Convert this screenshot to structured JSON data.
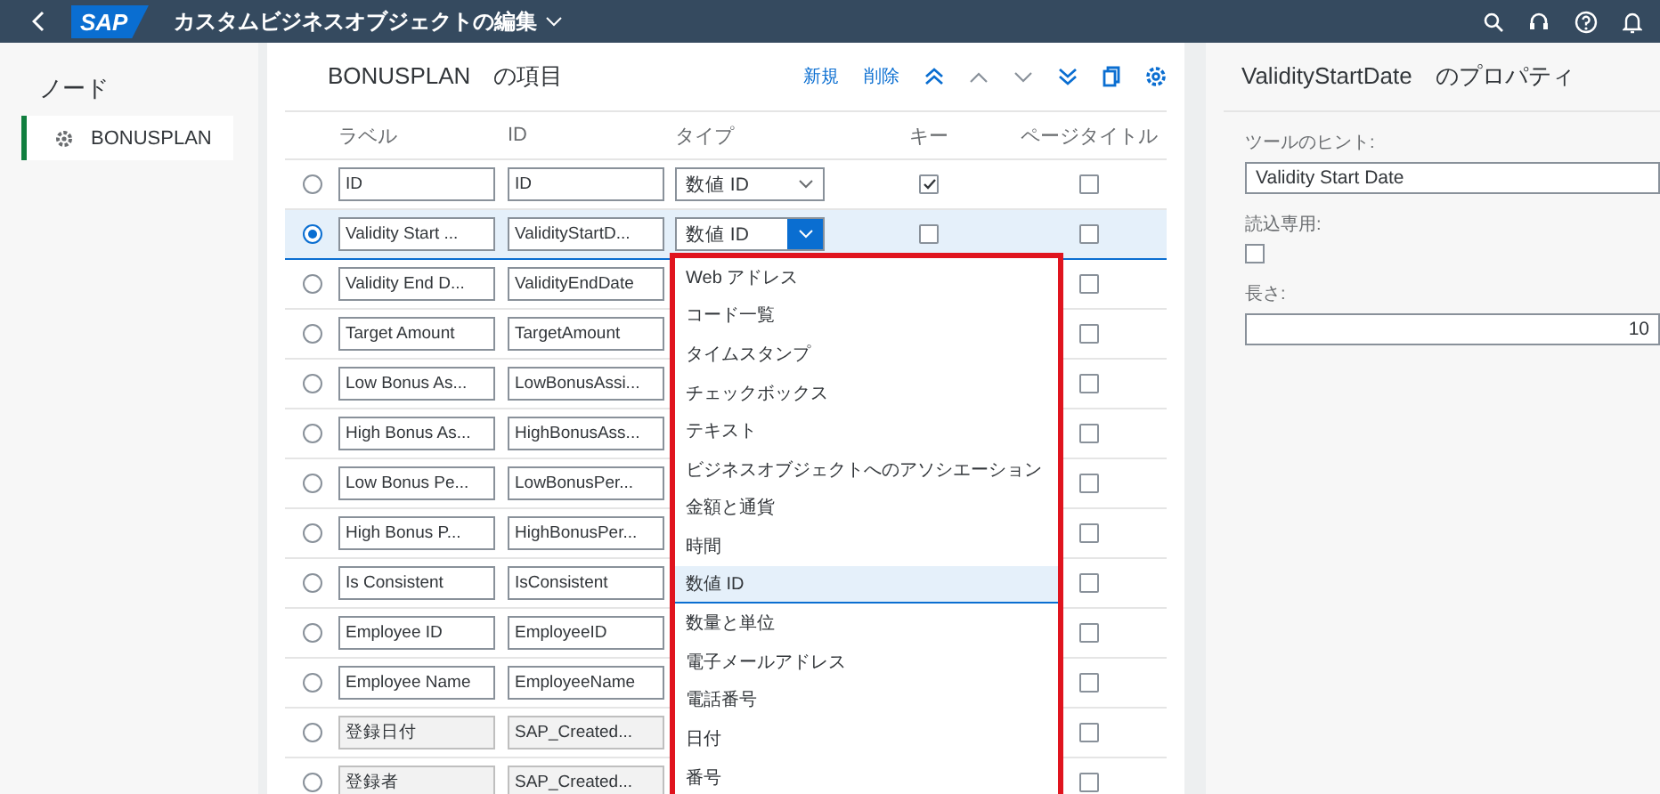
{
  "header": {
    "logo": "SAP",
    "title": "カスタムビジネスオブジェクトの編集"
  },
  "nodes": {
    "title": "ノード",
    "items": [
      {
        "label": "BONUSPLAN",
        "selected": true
      }
    ]
  },
  "fields": {
    "title": "BONUSPLAN　の項目",
    "actions": [
      "新規",
      "削除"
    ],
    "columns": [
      "ラベル",
      "ID",
      "タイプ",
      "キー",
      "ページタイトル"
    ],
    "rows": [
      {
        "selected": false,
        "label": "ID",
        "id": "ID",
        "readonly": false,
        "type": "数値 ID",
        "type_open": false,
        "key": true,
        "page_title": false
      },
      {
        "selected": true,
        "label": "Validity Start ...",
        "id": "ValidityStartD...",
        "readonly": false,
        "type": "数値 ID",
        "type_open": true,
        "key": false,
        "page_title": false
      },
      {
        "selected": false,
        "label": "Validity End D...",
        "id": "ValidityEndDate",
        "readonly": false,
        "page_title": false
      },
      {
        "selected": false,
        "label": "Target Amount",
        "id": "TargetAmount",
        "readonly": false,
        "page_title": false
      },
      {
        "selected": false,
        "label": "Low Bonus As...",
        "id": "LowBonusAssi...",
        "readonly": false,
        "page_title": false
      },
      {
        "selected": false,
        "label": "High Bonus As...",
        "id": "HighBonusAss...",
        "readonly": false,
        "page_title": false
      },
      {
        "selected": false,
        "label": "Low Bonus Pe...",
        "id": "LowBonusPer...",
        "readonly": false,
        "page_title": false
      },
      {
        "selected": false,
        "label": "High Bonus P...",
        "id": "HighBonusPer...",
        "readonly": false,
        "page_title": false
      },
      {
        "selected": false,
        "label": "Is Consistent",
        "id": "IsConsistent",
        "readonly": false,
        "page_title": false
      },
      {
        "selected": false,
        "label": "Employee ID",
        "id": "EmployeeID",
        "readonly": false,
        "page_title": false
      },
      {
        "selected": false,
        "label": "Employee Name",
        "id": "EmployeeName",
        "readonly": false,
        "page_title": false
      },
      {
        "selected": false,
        "label": "登録日付",
        "id": "SAP_Created...",
        "readonly": true,
        "page_title": false
      },
      {
        "selected": false,
        "label": "登録者",
        "id": "SAP_Created...",
        "readonly": true,
        "page_title": false
      }
    ]
  },
  "type_dropdown": {
    "options": [
      {
        "label": "Web アドレス",
        "selected": false
      },
      {
        "label": "コード一覧",
        "selected": false
      },
      {
        "label": "タイムスタンプ",
        "selected": false
      },
      {
        "label": "チェックボックス",
        "selected": false
      },
      {
        "label": "テキスト",
        "selected": false
      },
      {
        "label": "ビジネスオブジェクトへのアソシエーション",
        "selected": false
      },
      {
        "label": "金額と通貨",
        "selected": false
      },
      {
        "label": "時間",
        "selected": false
      },
      {
        "label": "数値 ID",
        "selected": true
      },
      {
        "label": "数量と単位",
        "selected": false
      },
      {
        "label": "電子メールアドレス",
        "selected": false
      },
      {
        "label": "電話番号",
        "selected": false
      },
      {
        "label": "日付",
        "selected": false
      },
      {
        "label": "番号",
        "selected": false
      }
    ]
  },
  "properties": {
    "title": "ValidityStartDate　のプロパティ",
    "tooltip_label": "ツールのヒント:",
    "tooltip_value": "Validity Start Date",
    "readonly_label": "読込専用:",
    "readonly_checked": false,
    "length_label": "長さ:",
    "length_value": "10"
  }
}
